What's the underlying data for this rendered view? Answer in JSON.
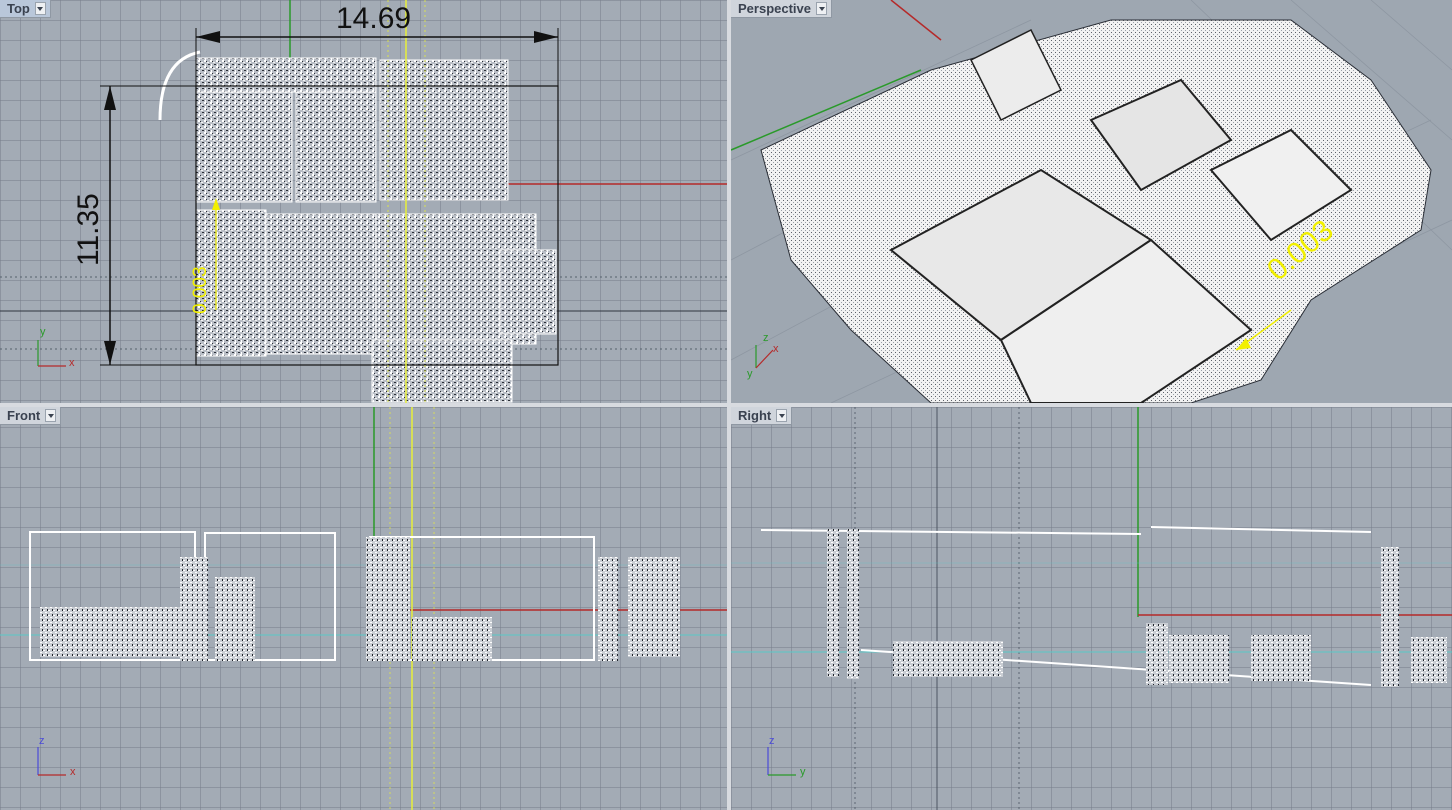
{
  "viewports": {
    "top": {
      "title": "Top",
      "dim_width": "14.69",
      "dim_height": "11.35",
      "annotation": "0.003",
      "axes": {
        "x": "x",
        "y": "y"
      }
    },
    "perspective": {
      "title": "Perspective",
      "annotation": "0.003",
      "axes": {
        "x": "x",
        "y": "y",
        "z": "z"
      }
    },
    "front": {
      "title": "Front",
      "axes": {
        "x": "x",
        "z": "z"
      }
    },
    "right": {
      "title": "Right",
      "axes": {
        "y": "y",
        "z": "z"
      }
    }
  },
  "colors": {
    "viewport_bg": "#a3abb5",
    "x_axis": "#b52a2a",
    "y_axis": "#2a9a2a",
    "annotation": "#f2f000",
    "pointcloud": "#ffffff"
  }
}
